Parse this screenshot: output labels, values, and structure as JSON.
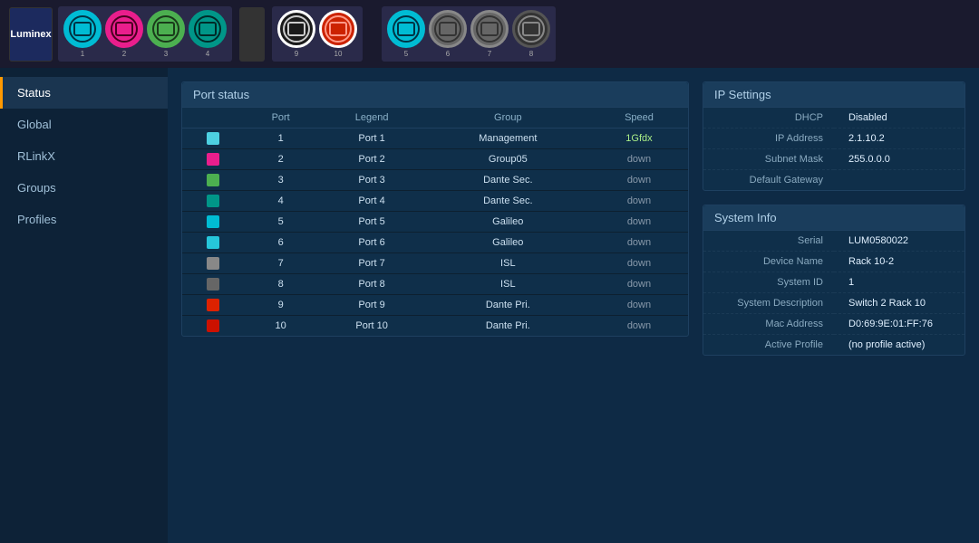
{
  "topBar": {
    "logo": "Luminex",
    "ports": [
      {
        "id": 1,
        "color": "cyan",
        "label": "1"
      },
      {
        "id": 2,
        "color": "magenta",
        "label": "2"
      },
      {
        "id": 3,
        "color": "green",
        "label": "3"
      },
      {
        "id": 4,
        "color": "teal",
        "label": "4"
      },
      {
        "id": 9,
        "color": "black-sel",
        "label": "9"
      },
      {
        "id": 10,
        "color": "red-sel",
        "label": "10"
      }
    ],
    "rightPorts": [
      {
        "id": 5,
        "color": "cyan",
        "label": "5"
      },
      {
        "id": 6,
        "color": "gray",
        "label": "6"
      },
      {
        "id": 7,
        "color": "gray",
        "label": "7"
      },
      {
        "id": 8,
        "color": "dark",
        "label": "8"
      }
    ]
  },
  "sidebar": {
    "items": [
      {
        "id": "status",
        "label": "Status",
        "active": true
      },
      {
        "id": "global",
        "label": "Global"
      },
      {
        "id": "rlinkx",
        "label": "RLinkX"
      },
      {
        "id": "groups",
        "label": "Groups"
      },
      {
        "id": "profiles",
        "label": "Profiles"
      }
    ]
  },
  "portStatus": {
    "header": "Port status",
    "columns": [
      "Port",
      "Legend",
      "Group",
      "Speed"
    ],
    "rows": [
      {
        "port": 1,
        "legend": "Port 1",
        "group": "Management",
        "speed": "1Gfdx",
        "color": "#4dd0e1"
      },
      {
        "port": 2,
        "legend": "Port 2",
        "group": "Group05",
        "speed": "down",
        "color": "#e91e8c"
      },
      {
        "port": 3,
        "legend": "Port 3",
        "group": "Dante Sec.",
        "speed": "down",
        "color": "#4caf50"
      },
      {
        "port": 4,
        "legend": "Port 4",
        "group": "Dante Sec.",
        "speed": "down",
        "color": "#009688"
      },
      {
        "port": 5,
        "legend": "Port 5",
        "group": "Galileo",
        "speed": "down",
        "color": "#00bcd4"
      },
      {
        "port": 6,
        "legend": "Port 6",
        "group": "Galileo",
        "speed": "down",
        "color": "#26c6da"
      },
      {
        "port": 7,
        "legend": "Port 7",
        "group": "ISL",
        "speed": "down",
        "color": "#888888"
      },
      {
        "port": 8,
        "legend": "Port 8",
        "group": "ISL",
        "speed": "down",
        "color": "#666666"
      },
      {
        "port": 9,
        "legend": "Port 9",
        "group": "Dante Pri.",
        "speed": "down",
        "color": "#dd2200"
      },
      {
        "port": 10,
        "legend": "Port 10",
        "group": "Dante Pri.",
        "speed": "down",
        "color": "#cc1100"
      }
    ]
  },
  "ipSettings": {
    "header": "IP Settings",
    "rows": [
      {
        "label": "DHCP",
        "value": "Disabled"
      },
      {
        "label": "IP Address",
        "value": "2.1.10.2"
      },
      {
        "label": "Subnet Mask",
        "value": "255.0.0.0"
      },
      {
        "label": "Default Gateway",
        "value": ""
      }
    ]
  },
  "systemInfo": {
    "header": "System Info",
    "rows": [
      {
        "label": "Serial",
        "value": "LUM0580022"
      },
      {
        "label": "Device Name",
        "value": "Rack 10-2"
      },
      {
        "label": "System ID",
        "value": "1"
      },
      {
        "label": "System Description",
        "value": "Switch 2 Rack 10"
      },
      {
        "label": "Mac Address",
        "value": "D0:69:9E:01:FF:76"
      },
      {
        "label": "Active Profile",
        "value": "(no profile active)"
      }
    ]
  }
}
